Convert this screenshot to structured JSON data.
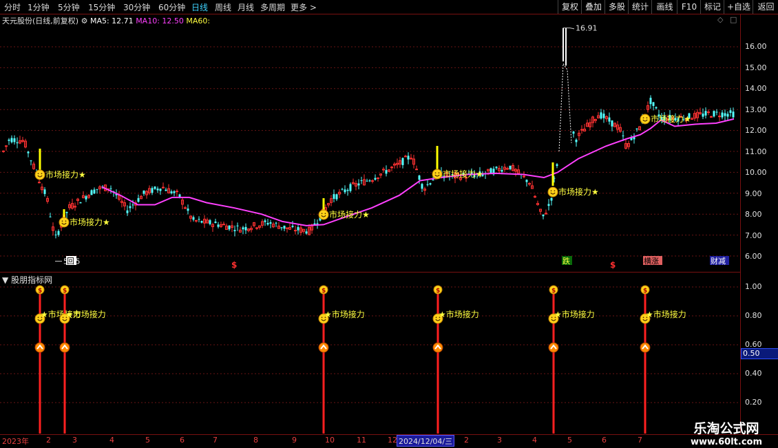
{
  "toolbar": {
    "timeframes": [
      "分时",
      "1分钟",
      "5分钟",
      "15分钟",
      "30分钟",
      "60分钟",
      "日线",
      "周线",
      "月线",
      "多周期",
      "更多 >"
    ],
    "active_index": 6,
    "right_buttons": [
      "复权",
      "叠加",
      "多股",
      "统计",
      "画线",
      "F10",
      "标记",
      "+自选",
      "返回"
    ]
  },
  "legend": {
    "stock_title": "天元股份(日线,前复权)",
    "ma5": "MA5: 12.71",
    "ma10": "MA10: 12.50",
    "ma60": "MA60:"
  },
  "main_panel": {
    "y_labels": [
      "16.00",
      "15.00",
      "14.00",
      "13.00",
      "12.00",
      "11.00",
      "10.00",
      "9.00",
      "8.00",
      "7.00",
      "6.00"
    ],
    "high_marker": "16.91",
    "low_marker": "5.75",
    "signal_label": "市场接力★",
    "badges": {
      "hui": "回",
      "die": "跌",
      "zhang": "横涨",
      "jian": "财减",
      "dollar": "$"
    }
  },
  "sub_panel": {
    "title": "股朋指标网",
    "y_labels": [
      "1.00",
      "0.80",
      "0.60",
      "0.40",
      "0.20"
    ],
    "current_value": "0.50",
    "signal_label": "市场接力"
  },
  "x_axis": {
    "year_label": "2023年",
    "month_labels": [
      "2",
      "3",
      "4",
      "5",
      "6",
      "7",
      "8",
      "9",
      "10",
      "11",
      "12",
      "2",
      "3",
      "4",
      "5",
      "6",
      "7"
    ],
    "cursor_date": "2024/12/04/三"
  },
  "watermark": {
    "line1": "乐淘公式网",
    "line2": "www.60lt.com"
  },
  "colors": {
    "up": "#ff3232",
    "down": "#54ffff",
    "ma60": "#ff40ff",
    "signal": "#ffff00",
    "axis_red": "#7a1010"
  }
}
